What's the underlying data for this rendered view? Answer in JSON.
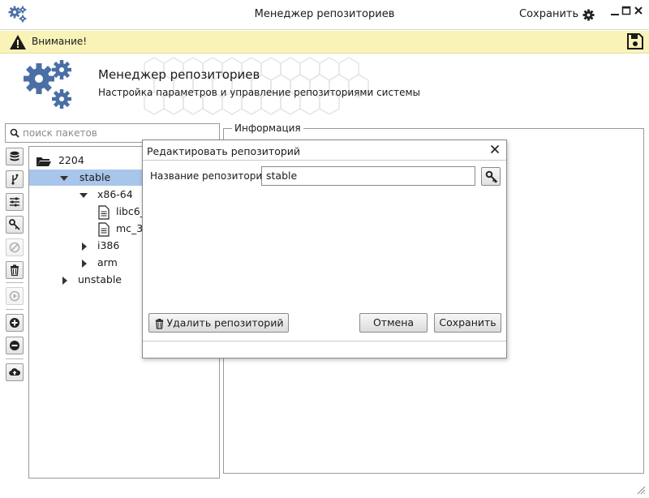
{
  "window": {
    "title": "Менеджер репозиториев",
    "save_label": "Сохранить",
    "icons": [
      "app-gears-icon",
      "gear-icon",
      "minimize-icon",
      "maximize-icon",
      "close-icon"
    ]
  },
  "warning": {
    "text": "Внимание!",
    "icons": [
      "warning-icon",
      "save-disk-icon"
    ]
  },
  "header": {
    "title": "Менеджер репозиториев",
    "subtitle": "Настройка параметров и управление репозиториями системы"
  },
  "search": {
    "placeholder": "поиск пакетов"
  },
  "toolbar": {
    "buttons": [
      {
        "icon": "database-icon",
        "enabled": true
      },
      {
        "icon": "branch-icon",
        "enabled": true
      },
      {
        "icon": "settings-sliders-icon",
        "enabled": true
      },
      {
        "icon": "key-icon",
        "enabled": true
      },
      {
        "icon": "block-icon",
        "enabled": false
      },
      {
        "icon": "trash-icon",
        "enabled": true
      },
      {
        "icon": "play-icon",
        "enabled": false
      },
      {
        "icon": "add-icon",
        "enabled": true
      },
      {
        "icon": "remove-icon",
        "enabled": true
      },
      {
        "icon": "cloud-upload-icon",
        "enabled": true
      }
    ]
  },
  "tree": {
    "root": "2204",
    "items": [
      {
        "label": "stable",
        "expanded": true,
        "selected": true
      },
      {
        "label": "x86-64",
        "expanded": true
      },
      {
        "label": "libc6_"
      },
      {
        "label": "mc_3"
      },
      {
        "label": "i386",
        "expanded": false
      },
      {
        "label": "arm",
        "expanded": false
      },
      {
        "label": "unstable",
        "expanded": false
      }
    ]
  },
  "info": {
    "legend": "Информация"
  },
  "dialog": {
    "title": "Редактировать репозиторий",
    "name_label": "Название репозитория:",
    "name_value": "stable",
    "delete_label": "Удалить репозиторий",
    "cancel_label": "Отмена",
    "save_label": "Сохранить"
  },
  "colors": {
    "accent_blue": "#4a6fa5",
    "selection": "#a8c6ea",
    "warning_bg": "#f9f3b8"
  }
}
